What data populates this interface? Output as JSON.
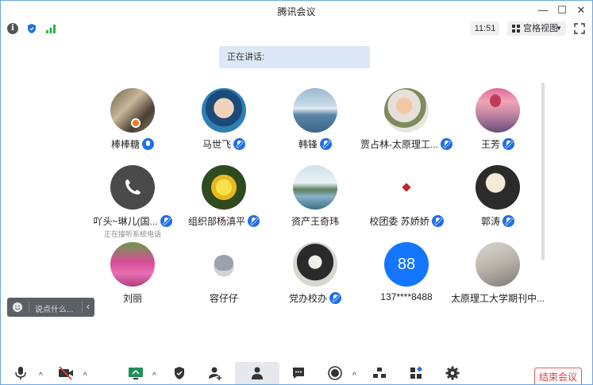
{
  "window": {
    "title": "腾讯会议"
  },
  "toolbar": {
    "time": "11:51",
    "view_mode": "宫格视图"
  },
  "speaking": {
    "label": "正在讲话:"
  },
  "participants": [
    {
      "name": "棒棒糖",
      "mic": "active"
    },
    {
      "name": "马世飞",
      "mic": "muted"
    },
    {
      "name": "韩锋",
      "mic": "muted"
    },
    {
      "name": "贾占林-太原理工...",
      "mic": "muted"
    },
    {
      "name": "王芳",
      "mic": "muted"
    },
    {
      "name": "吖头~琳儿(国...",
      "mic": "muted",
      "status": "正在接听系统电话"
    },
    {
      "name": "组织部杨滇平",
      "mic": "muted"
    },
    {
      "name": "资产王奇玮",
      "mic": "none"
    },
    {
      "name": "校团委 苏娇娇",
      "mic": "muted"
    },
    {
      "name": "郭涛",
      "mic": "muted"
    },
    {
      "name": "刘丽",
      "mic": "none"
    },
    {
      "name": "容仔仔",
      "mic": "none"
    },
    {
      "name": "党办校办",
      "mic": "muted"
    },
    {
      "name": "137****8488",
      "mic": "none",
      "avatar_text": "88"
    },
    {
      "name": "太原理工大学期刊中...",
      "mic": "none"
    }
  ],
  "chat": {
    "placeholder": "说点什么..."
  },
  "bottom": {
    "end_label": "结束会议",
    "colors": {
      "accent": "#1f6fe5",
      "end": "#e23b3b"
    }
  }
}
